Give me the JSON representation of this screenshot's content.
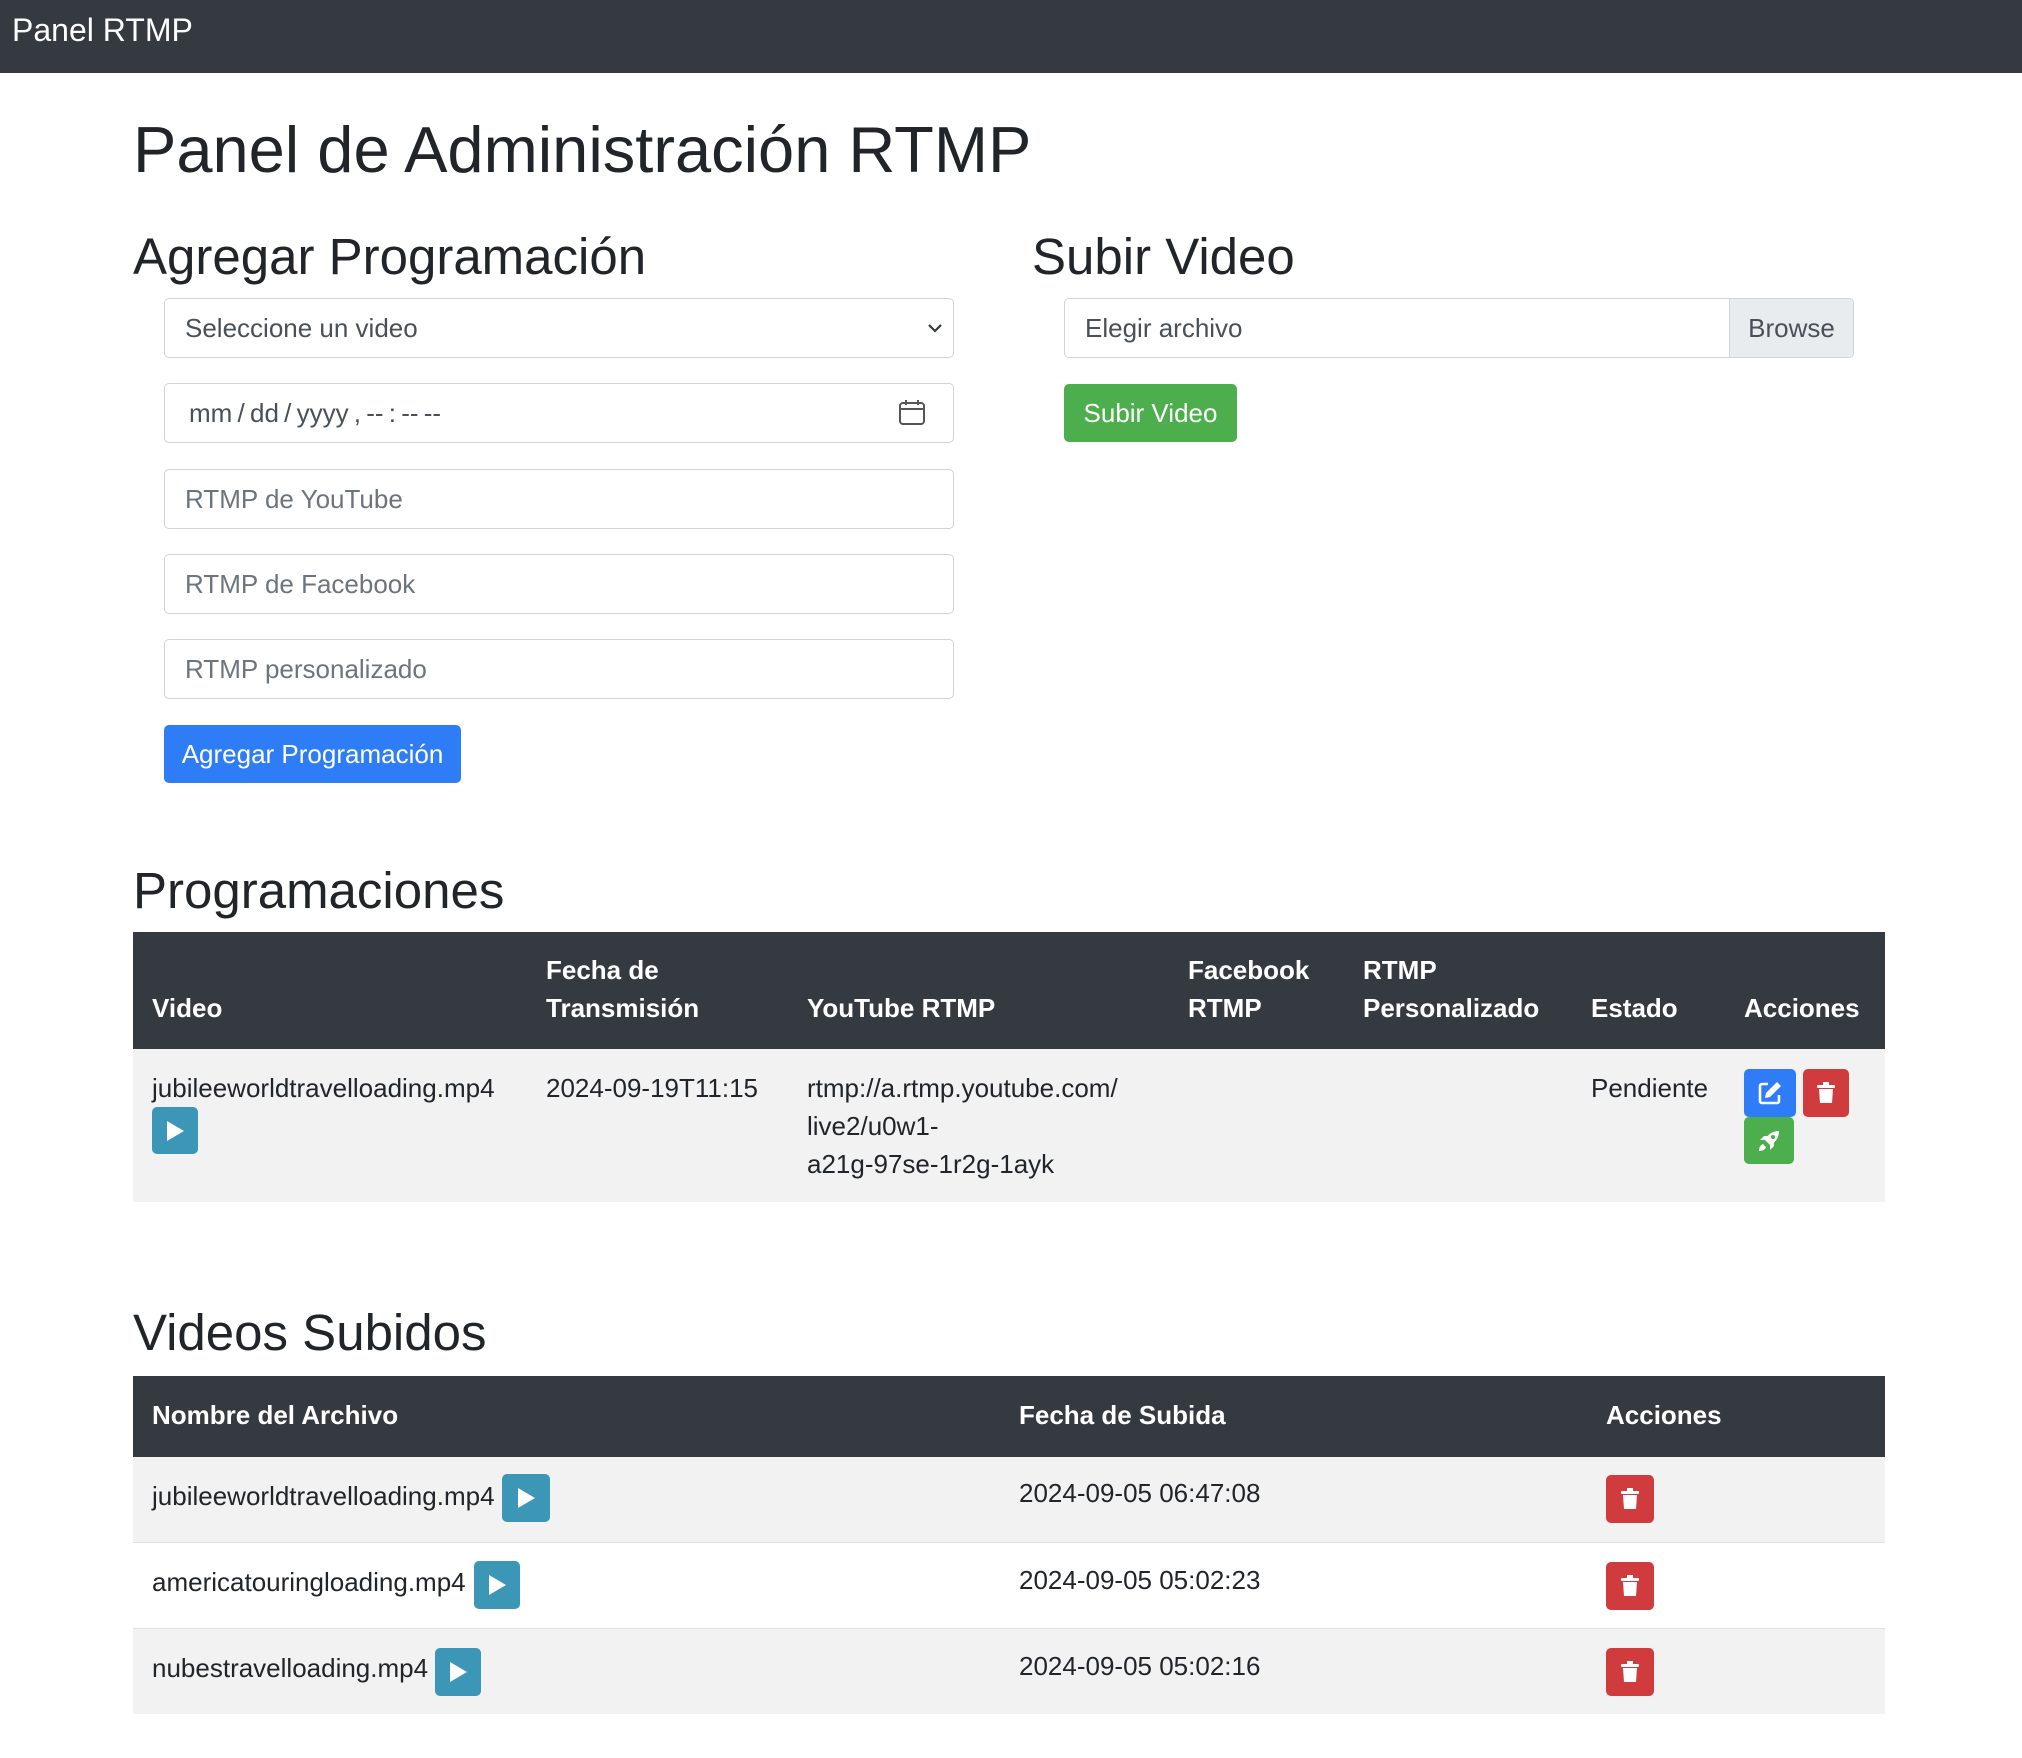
{
  "navbar": {
    "brand": "Panel RTMP"
  },
  "page_title": "Panel de Administración RTMP",
  "schedule_form": {
    "heading": "Agregar Programación",
    "video_select": "Seleccione un video",
    "datetime_placeholder": "mm / dd / yyyy ,  -- : --   --",
    "youtube_placeholder": "RTMP de YouTube",
    "facebook_placeholder": "RTMP de Facebook",
    "custom_placeholder": "RTMP personalizado",
    "submit_label": "Agregar Programación"
  },
  "upload_form": {
    "heading": "Subir Video",
    "file_text": "Elegir archivo",
    "browse_label": "Browse",
    "submit_label": "Subir Video"
  },
  "schedules": {
    "heading": "Programaciones",
    "columns": {
      "video": "Video",
      "date_l1": "Fecha de",
      "date_l2": "Transmisión",
      "youtube": "YouTube RTMP",
      "facebook_l1": "Facebook",
      "facebook_l2": "RTMP",
      "custom_l1": "RTMP",
      "custom_l2": "Personalizado",
      "status": "Estado",
      "actions": "Acciones"
    },
    "rows": [
      {
        "video": "jubileeworldtravelloading.mp4",
        "date": "2024-09-19T11:15",
        "youtube_l1": "rtmp://a.rtmp.youtube.com/",
        "youtube_l2": "live2/u0w1-",
        "youtube_l3": "a21g-97se-1r2g-1ayk",
        "facebook": "",
        "custom": "",
        "status": "Pendiente"
      }
    ]
  },
  "videos": {
    "heading": "Videos Subidos",
    "columns": {
      "filename": "Nombre del Archivo",
      "upload_date": "Fecha de Subida",
      "actions": "Acciones"
    },
    "rows": [
      {
        "filename": "jubileeworldtravelloading.mp4",
        "date": "2024-09-05 06:47:08"
      },
      {
        "filename": "americatouringloading.mp4",
        "date": "2024-09-05 05:02:23"
      },
      {
        "filename": "nubestravelloading.mp4",
        "date": "2024-09-05 05:02:16"
      }
    ]
  },
  "colors": {
    "navbar": "#343a40",
    "primary": "#2f7df6",
    "success": "#4cae4c",
    "danger": "#d03c3e",
    "info": "#3b97b5"
  }
}
